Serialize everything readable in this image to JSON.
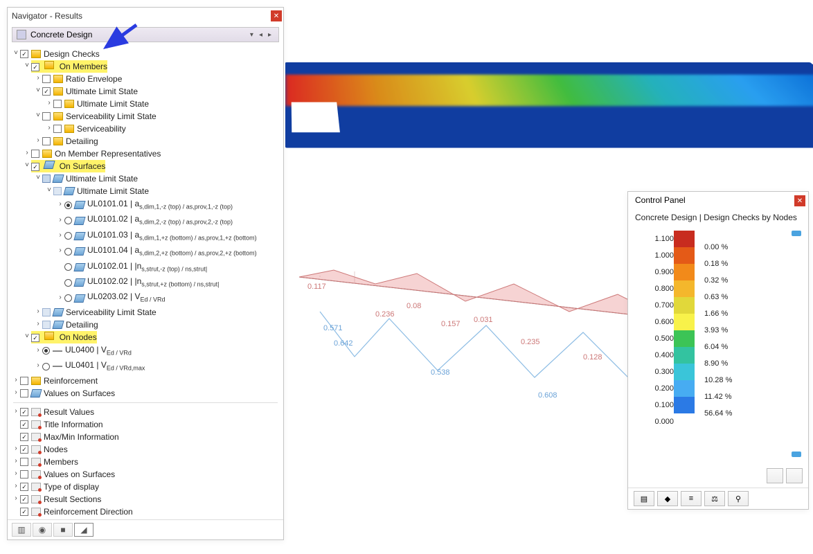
{
  "navigator": {
    "title": "Navigator - Results",
    "selector_label": "Concrete Design",
    "groups": {
      "design_checks": "Design Checks",
      "on_members": "On Members",
      "ratio_envelope": "Ratio Envelope",
      "uls1": "Ultimate Limit State",
      "uls1_sub": "Ultimate Limit State",
      "sls1": "Serviceability Limit State",
      "serviceability": "Serviceability",
      "detailing1": "Detailing",
      "on_member_reps": "On Member Representatives",
      "on_surfaces": "On Surfaces",
      "uls2": "Ultimate Limit State",
      "uls2_sub": "Ultimate Limit State",
      "ul0101_01": "UL0101.01 | a",
      "ul0101_01_tail": "s,dim,1,-z (top) / as,prov,1,-z (top)",
      "ul0101_02": "UL0101.02 | a",
      "ul0101_02_tail": "s,dim,2,-z (top) / as,prov,2,-z (top)",
      "ul0101_03": "UL0101.03 | a",
      "ul0101_03_tail": "s,dim,1,+z (bottom) / as,prov,1,+z (bottom)",
      "ul0101_04": "UL0101.04 | a",
      "ul0101_04_tail": "s,dim,2,+z (bottom) / as,prov,2,+z (bottom)",
      "ul0102_01": "UL0102.01 | |n",
      "ul0102_01_tail": "s,strut,-z (top) / ns,strut|",
      "ul0102_02": "UL0102.02 | |n",
      "ul0102_02_tail": "s,strut,+z (bottom) / ns,strut|",
      "ul0203_02": "UL0203.02 | V",
      "ul0203_02_tail": "Ed / VRd",
      "sls2": "Serviceability Limit State",
      "detailing2": "Detailing",
      "on_nodes": "On Nodes",
      "ul0400": "UL0400 | V",
      "ul0400_tail": "Ed / VRd",
      "ul0401": "UL0401 | V",
      "ul0401_tail": "Ed / VRd,max",
      "reinforcement": "Reinforcement",
      "values_on_surfaces": "Values on Surfaces"
    },
    "result_opts": {
      "result_values": "Result Values",
      "title_info": "Title Information",
      "maxmin": "Max/Min Information",
      "nodes": "Nodes",
      "members": "Members",
      "val_on_surf": "Values on Surfaces",
      "type_disp": "Type of display",
      "result_sections": "Result Sections",
      "reinf_dir": "Reinforcement Direction"
    }
  },
  "viewport": {
    "beam_values": {
      "top": [
        "0.117",
        "0.236",
        "0.08",
        "0.157",
        "0.031",
        "0.235",
        "0.128"
      ],
      "bottom": [
        "0.571",
        "0.642",
        "0.538",
        "0.608"
      ]
    }
  },
  "control_panel": {
    "title": "Control Panel",
    "subtitle": "Concrete Design | Design Checks by Nodes",
    "scale": [
      "1.100",
      "1.000",
      "0.900",
      "0.800",
      "0.700",
      "0.600",
      "0.500",
      "0.400",
      "0.300",
      "0.200",
      "0.100",
      "0.000"
    ],
    "percents": [
      "0.00 %",
      "0.18 %",
      "0.32 %",
      "0.63 %",
      "1.66 %",
      "3.93 %",
      "6.04 %",
      "8.90 %",
      "10.28 %",
      "11.42 %",
      "56.64 %"
    ],
    "colors": [
      "#c82c1f",
      "#e45a17",
      "#f28a1a",
      "#f4b72c",
      "#e1d83a",
      "#f8f24a",
      "#3cc456",
      "#33c3a0",
      "#3ac5d9",
      "#47acf2",
      "#2b7ae5",
      "#153f9e"
    ]
  }
}
